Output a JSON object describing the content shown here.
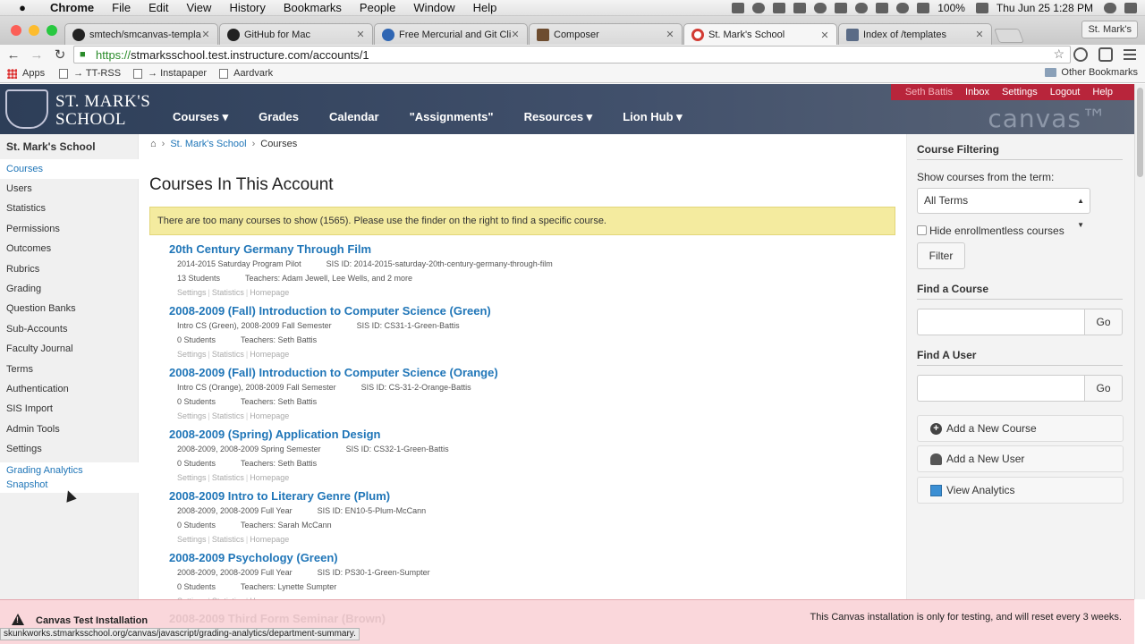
{
  "menubar": {
    "apple": "",
    "app": "Chrome",
    "items": [
      "File",
      "Edit",
      "View",
      "History",
      "Bookmarks",
      "People",
      "Window",
      "Help"
    ],
    "battery": "100%",
    "clock": "Thu Jun 25  1:28 PM"
  },
  "tabs": [
    {
      "title": "smtech/smcanvas-templat",
      "favicon_color": "#222222"
    },
    {
      "title": "GitHub for Mac",
      "favicon_color": "#222222"
    },
    {
      "title": "Free Mercurial and Git Clie",
      "favicon_color": "#2f66b3"
    },
    {
      "title": "Composer",
      "favicon_color": "#6d4c2f"
    },
    {
      "title": "St. Mark's School",
      "favicon_color": "#d23b33"
    },
    {
      "title": "Index of /templates",
      "favicon_color": "#5a6b86"
    }
  ],
  "profile": "St. Mark's",
  "address": {
    "scheme": "https://",
    "rest": "stmarksschool.test.instructure.com/accounts/1"
  },
  "bookmarks": {
    "items": [
      "Apps",
      "→ TT-RSS",
      "→ Instapaper",
      "Aardvark"
    ],
    "other": "Other Bookmarks"
  },
  "header": {
    "school_line1": "ST. MARK'S",
    "school_line2": "SCHOOL",
    "nav": [
      "Courses ▾",
      "Grades",
      "Calendar",
      "\"Assignments\"",
      "Resources ▾",
      "Lion Hub ▾"
    ],
    "user": "Seth Battis",
    "user_links": [
      "Inbox",
      "Settings",
      "Logout",
      "Help"
    ],
    "logo": "canvas™"
  },
  "leftnav": {
    "account": "St. Mark's School",
    "links": [
      "Courses",
      "Users",
      "Statistics",
      "Permissions",
      "Outcomes",
      "Rubrics",
      "Grading",
      "Question Banks",
      "Sub-Accounts",
      "Faculty Journal",
      "Terms",
      "Authentication",
      "SIS Import",
      "Admin Tools",
      "Settings"
    ],
    "special_line1": "Grading Analytics",
    "special_line2": "Snapshot"
  },
  "breadcrumb": {
    "home_icon": "⌂",
    "level1": "St. Mark's School",
    "level2": "Courses",
    "sep": "›"
  },
  "page_title": "Courses In This Account",
  "notice": "There are too many courses to show (1565). Please use the finder on the right to find a specific course.",
  "courses": [
    {
      "title": "20th Century Germany Through Film",
      "term": "2014-2015 Saturday Program Pilot",
      "sis": "SIS ID: 2014-2015-saturday-20th-century-germany-through-film",
      "students": "13 Students",
      "teachers": "Teachers: Adam Jewell, Lee Wells, and 2 more"
    },
    {
      "title": "2008-2009 (Fall) Introduction to Computer Science (Green)",
      "term": "Intro CS (Green), 2008-2009 Fall Semester",
      "sis": "SIS ID: CS31-1-Green-Battis",
      "students": "0 Students",
      "teachers": "Teachers: Seth Battis"
    },
    {
      "title": "2008-2009 (Fall) Introduction to Computer Science (Orange)",
      "term": "Intro CS (Orange), 2008-2009 Fall Semester",
      "sis": "SIS ID: CS-31-2-Orange-Battis",
      "students": "0 Students",
      "teachers": "Teachers: Seth Battis"
    },
    {
      "title": "2008-2009 (Spring) Application Design",
      "term": "2008-2009, 2008-2009 Spring Semester",
      "sis": "SIS ID: CS32-1-Green-Battis",
      "students": "0 Students",
      "teachers": "Teachers: Seth Battis"
    },
    {
      "title": "2008-2009 Intro to Literary Genre (Plum)",
      "term": "2008-2009, 2008-2009 Full Year",
      "sis": "SIS ID: EN10-5-Plum-McCann",
      "students": "0 Students",
      "teachers": "Teachers: Sarah McCann"
    },
    {
      "title": "2008-2009 Psychology (Green)",
      "term": "2008-2009, 2008-2009 Full Year",
      "sis": "SIS ID: PS30-1-Green-Sumpter",
      "students": "0 Students",
      "teachers": "Teachers: Lynette Sumpter"
    }
  ],
  "course_links": {
    "settings": "Settings",
    "statistics": "Statistics",
    "homepage": "Homepage",
    "divider": "|"
  },
  "sidebar": {
    "filtering_heading": "Course Filtering",
    "term_label": "Show courses from the term:",
    "term_value": "All Terms",
    "hide_label": "Hide enrollmentless courses",
    "filter_button": "Filter",
    "find_course_heading": "Find a Course",
    "find_user_heading": "Find A User",
    "go_label": "Go",
    "add_course": "Add a New Course",
    "add_user": "Add a New User",
    "view_analytics": "View Analytics"
  },
  "test_banner": {
    "title": "Canvas Test Installation",
    "message": "This Canvas installation is only for testing, and will reset every 3 weeks.",
    "hidden_course": "2008-2009 Third Form Seminar (Brown)"
  },
  "status_url": "skunkworks.stmarksschool.org/canvas/javascript/grading-analytics/department-summary.",
  "colors": {
    "link": "#2076b8",
    "header_bg": "#33445f",
    "user_bar": "#b8253b",
    "notice_bg": "#f4eb9f",
    "test_banner": "#fad7db"
  }
}
